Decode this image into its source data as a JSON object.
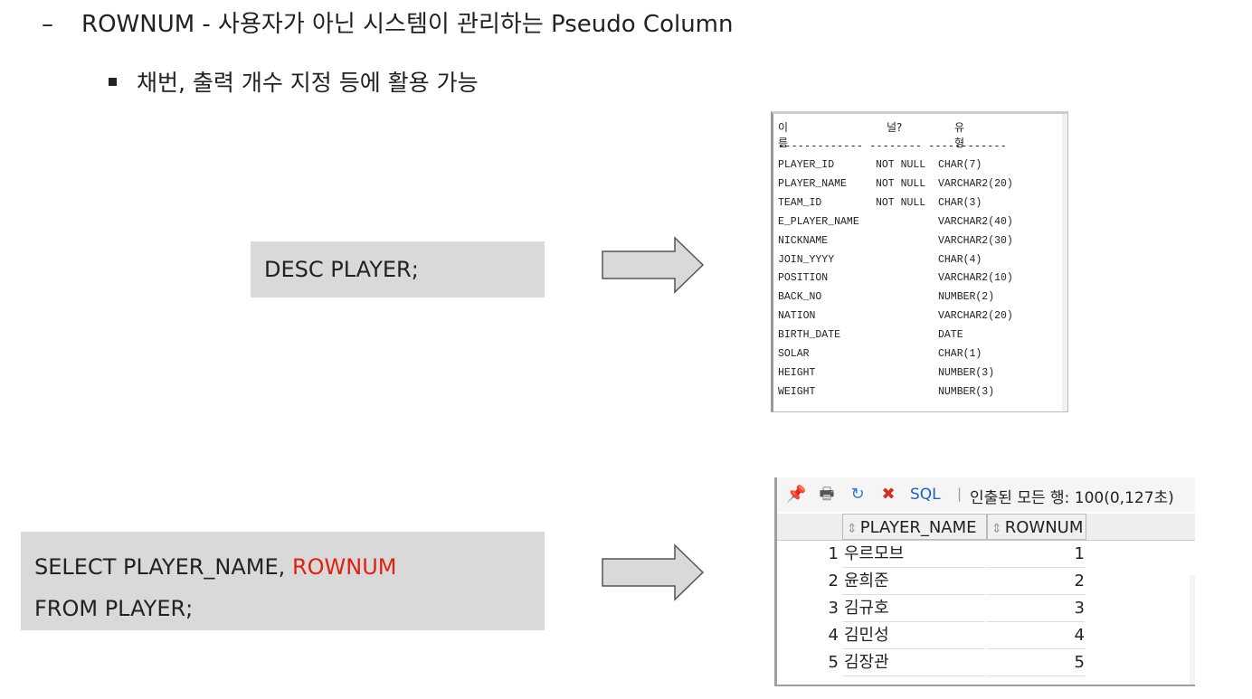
{
  "heading": {
    "dash": "–",
    "text": "ROWNUM - 사용자가 아닌 시스템이 관리하는 Pseudo Column"
  },
  "subbullet": {
    "text": "채번, 출력 개수 지정 등에 활용 가능"
  },
  "query1": {
    "text": "DESC PLAYER;"
  },
  "query2": {
    "line1_prefix": "SELECT PLAYER_NAME, ",
    "line1_highlight": "ROWNUM",
    "line2": "FROM PLAYER;",
    "highlight_color": "#e02010"
  },
  "desc_output": {
    "headers": {
      "name": "이름",
      "null": "널?",
      "type": "유형"
    },
    "separator": "------------- -------- ------------",
    "rows": [
      {
        "name": "PLAYER_ID",
        "null": "NOT NULL",
        "type": "CHAR(7)"
      },
      {
        "name": "PLAYER_NAME",
        "null": "NOT NULL",
        "type": "VARCHAR2(20)"
      },
      {
        "name": "TEAM_ID",
        "null": "NOT NULL",
        "type": "CHAR(3)"
      },
      {
        "name": "E_PLAYER_NAME",
        "null": "",
        "type": "VARCHAR2(40)"
      },
      {
        "name": "NICKNAME",
        "null": "",
        "type": "VARCHAR2(30)"
      },
      {
        "name": "JOIN_YYYY",
        "null": "",
        "type": "CHAR(4)"
      },
      {
        "name": "POSITION",
        "null": "",
        "type": "VARCHAR2(10)"
      },
      {
        "name": "BACK_NO",
        "null": "",
        "type": "NUMBER(2)"
      },
      {
        "name": "NATION",
        "null": "",
        "type": "VARCHAR2(20)"
      },
      {
        "name": "BIRTH_DATE",
        "null": "",
        "type": "DATE"
      },
      {
        "name": "SOLAR",
        "null": "",
        "type": "CHAR(1)"
      },
      {
        "name": "HEIGHT",
        "null": "",
        "type": "NUMBER(3)"
      },
      {
        "name": "WEIGHT",
        "null": "",
        "type": "NUMBER(3)"
      }
    ]
  },
  "result": {
    "toolbar": {
      "icons": [
        "pin-icon",
        "print-icon",
        "refresh-icon",
        "export-icon"
      ],
      "sql_label": "SQL",
      "separator": "|",
      "status": "인출된 모든 행: 100(0,127초)"
    },
    "columns": [
      "PLAYER_NAME",
      "ROWNUM"
    ],
    "rows": [
      {
        "idx": "1",
        "name": "우르모브",
        "rownum": "1"
      },
      {
        "idx": "2",
        "name": "윤희준",
        "rownum": "2"
      },
      {
        "idx": "3",
        "name": "김규호",
        "rownum": "3"
      },
      {
        "idx": "4",
        "name": "김민성",
        "rownum": "4"
      },
      {
        "idx": "5",
        "name": "김장관",
        "rownum": "5"
      }
    ]
  }
}
